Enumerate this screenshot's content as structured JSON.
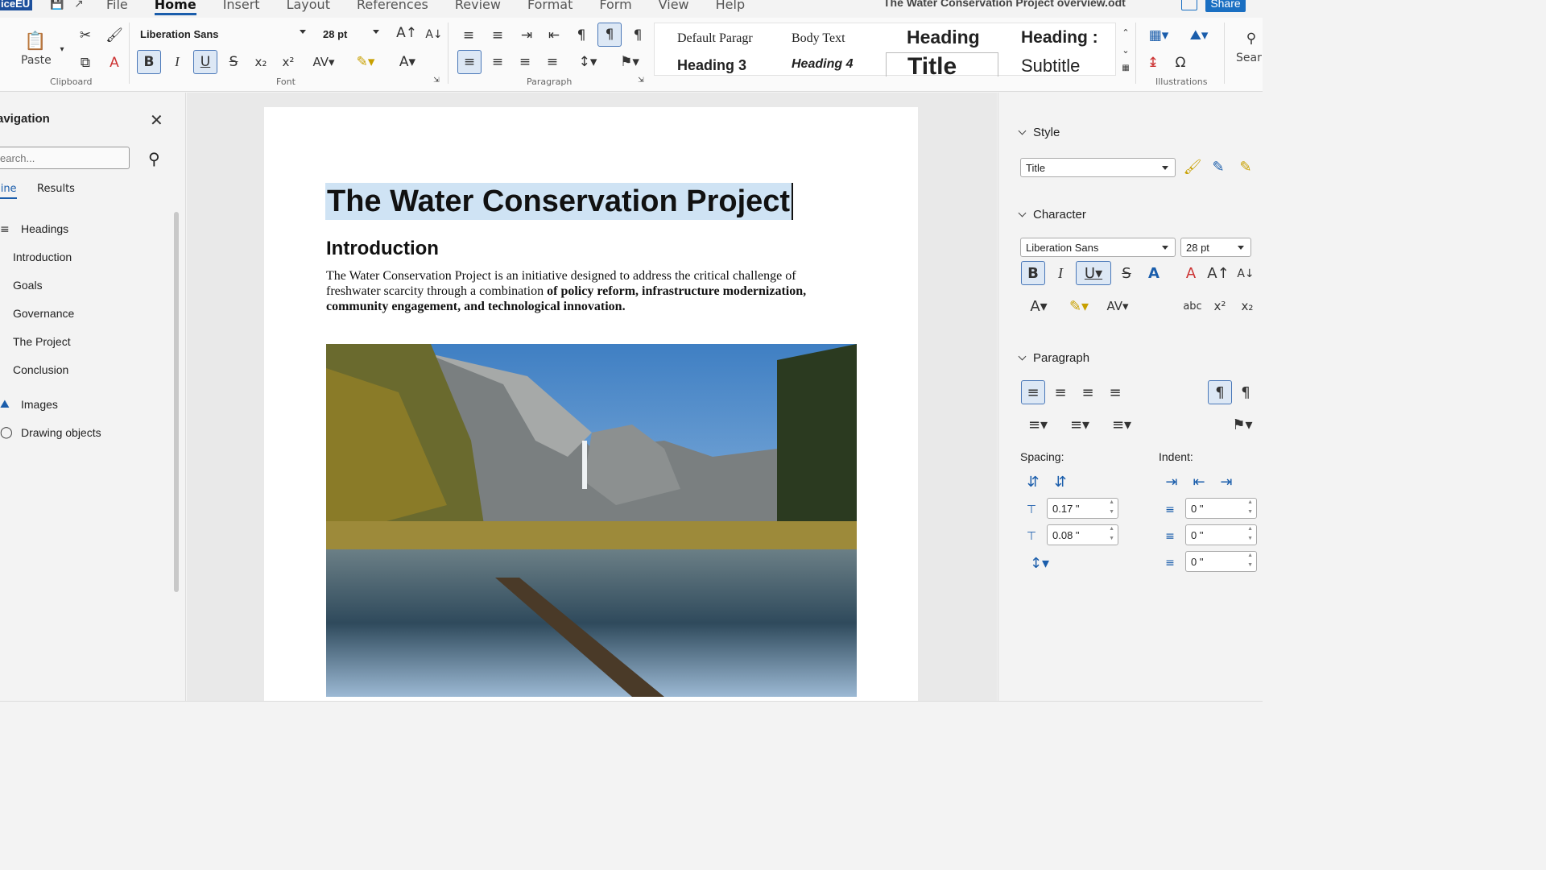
{
  "app": {
    "logo": "iceEU",
    "document_title": "The Water Conservation Project overview.odt",
    "share_label": "Share"
  },
  "menu": [
    "File",
    "Home",
    "Insert",
    "Layout",
    "References",
    "Review",
    "Format",
    "Form",
    "View",
    "Help"
  ],
  "ribbon": {
    "clipboard": {
      "paste_label": "Paste",
      "group_label": "Clipboard"
    },
    "font": {
      "font_name": "Liberation Sans",
      "font_size": "28 pt",
      "group_label": "Font"
    },
    "paragraph": {
      "group_label": "Paragraph"
    },
    "styles": {
      "default": "Default Paragr",
      "body_text": "Body Text",
      "heading1": "Heading",
      "heading2": "Heading :",
      "heading3": "Heading 3",
      "heading4": "Heading 4",
      "title": "Title",
      "subtitle": "Subtitle"
    },
    "illustrations": {
      "group_label": "Illustrations"
    },
    "search_label": "Sear"
  },
  "navigator": {
    "title": "avigation",
    "search_placeholder": "earch...",
    "tabs": [
      "tline",
      "Results"
    ],
    "items": [
      {
        "label": "Headings",
        "level": 0
      },
      {
        "label": "Introduction",
        "level": 1
      },
      {
        "label": "Goals",
        "level": 1
      },
      {
        "label": "Governance",
        "level": 1
      },
      {
        "label": "The Project",
        "level": 1
      },
      {
        "label": "Conclusion",
        "level": 1
      },
      {
        "label": "Images",
        "level": 0
      },
      {
        "label": "Drawing objects",
        "level": 0
      }
    ]
  },
  "document": {
    "title": "The Water Conservation Project",
    "heading": "Introduction",
    "para_plain": "The Water Conservation Project is an initiative designed to address the critical challenge of freshwater scarcity through a combination ",
    "para_bold": "of policy reform, infrastructure modernization, community engagement, and technological innovation."
  },
  "sidebar": {
    "style_section": "Style",
    "style_value": "Title",
    "character_section": "Character",
    "char_font": "Liberation Sans",
    "char_size": "28 pt",
    "paragraph_section": "Paragraph",
    "spacing_label": "Spacing:",
    "indent_label": "Indent:",
    "spacing_above": "0.17 \"",
    "spacing_below": "0.08 \"",
    "indent_before": "0 \"",
    "indent_after": "0 \"",
    "indent_first": "0 \""
  },
  "colors": {
    "accent": "#1a5dab",
    "selection": "#cfe3f4"
  }
}
